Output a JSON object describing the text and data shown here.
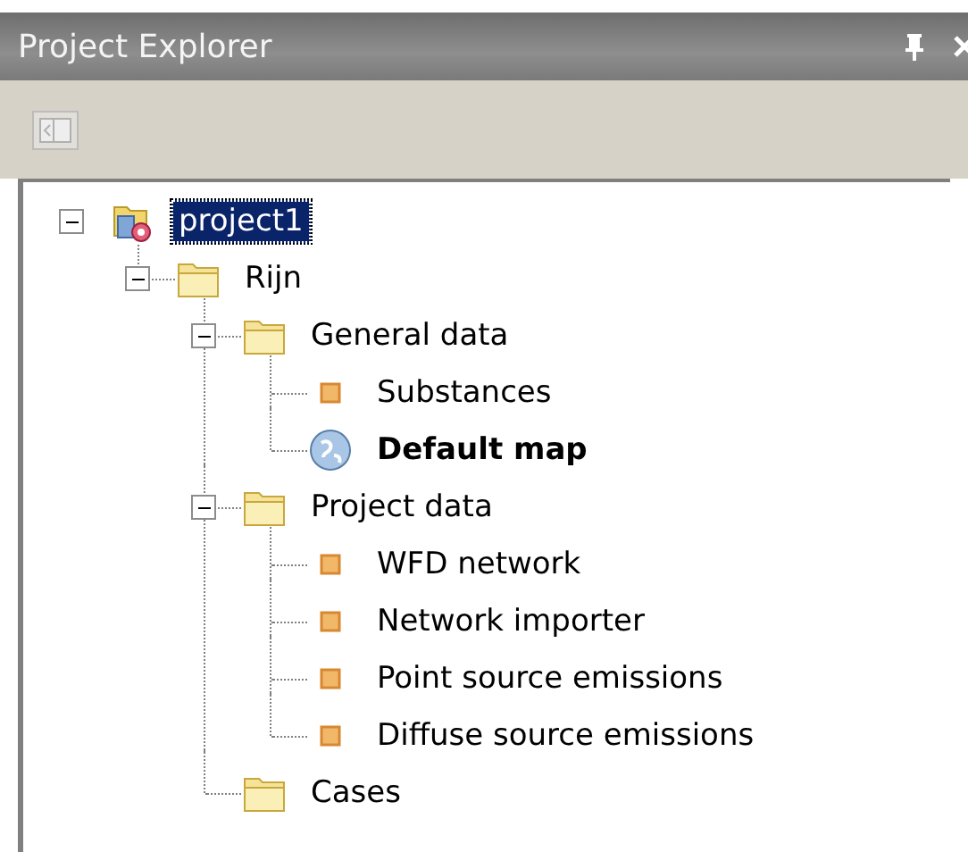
{
  "window": {
    "title": "Project Explorer"
  },
  "tree": [
    {
      "label": "project1",
      "kind": "project",
      "selected": true,
      "bold": false,
      "expanded": true,
      "children": [
        {
          "label": "Rijn",
          "kind": "folder",
          "selected": false,
          "bold": false,
          "expanded": true,
          "children": [
            {
              "label": "General data",
              "kind": "folder",
              "selected": false,
              "bold": false,
              "expanded": true,
              "children": [
                {
                  "label": "Substances",
                  "kind": "item",
                  "selected": false,
                  "bold": false
                },
                {
                  "label": "Default map",
                  "kind": "map",
                  "selected": false,
                  "bold": true
                }
              ]
            },
            {
              "label": "Project data",
              "kind": "folder",
              "selected": false,
              "bold": false,
              "expanded": true,
              "children": [
                {
                  "label": "WFD network",
                  "kind": "item",
                  "selected": false,
                  "bold": false
                },
                {
                  "label": "Network importer",
                  "kind": "item",
                  "selected": false,
                  "bold": false
                },
                {
                  "label": "Point source emissions",
                  "kind": "item",
                  "selected": false,
                  "bold": false
                },
                {
                  "label": "Diffuse source emissions",
                  "kind": "item",
                  "selected": false,
                  "bold": false
                }
              ]
            },
            {
              "label": "Cases",
              "kind": "folder",
              "selected": false,
              "bold": false
            }
          ]
        }
      ]
    }
  ]
}
